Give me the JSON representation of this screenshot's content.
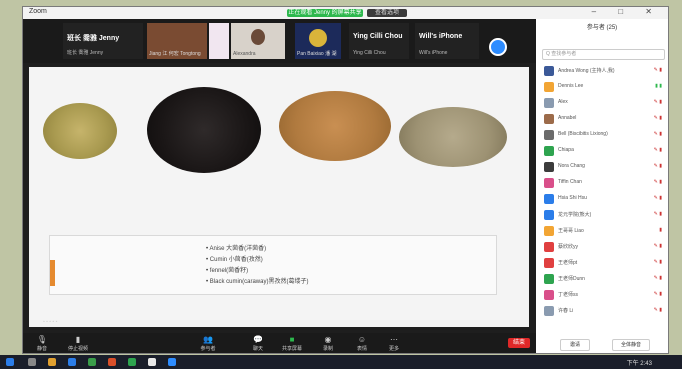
{
  "window": {
    "app_title": "Zoom",
    "recording_pill": "正在观看 Jenny 的屏幕共享",
    "view_pill": "查看选项"
  },
  "participants_strip": [
    {
      "name": "班长 喬雅 Jenny",
      "sub": "班长 喬雅 Jenny"
    },
    {
      "name": "",
      "sub": "Jiang 江 何宏 Tongtong"
    },
    {
      "name": "",
      "sub": "Alexandra"
    },
    {
      "name": "",
      "sub": "Pan Baixiao 潘 湖"
    },
    {
      "name": "Ying Cilli Chou",
      "sub": "Ying Cilli Chou"
    },
    {
      "name": "Will's iPhone",
      "sub": "Will's iPhone"
    }
  ],
  "slide": {
    "bullets": [
      "Anise 大茴香(洋茴香)",
      "Cumin 小茴香(孜然)",
      "fennel(茴香籽)",
      "Black cumin(caraway)黑孜然(葛缕子)"
    ],
    "footer": "◦ ◦ ◦ ◦ ◦"
  },
  "toolbar": {
    "items": [
      {
        "icon": "mic-icon",
        "label": "静音"
      },
      {
        "icon": "camera-icon",
        "label": "停止视频"
      },
      {
        "icon": "participants-icon",
        "label": "参与者"
      },
      {
        "icon": "chat-icon",
        "label": "聊天"
      },
      {
        "icon": "share-icon",
        "label": "共享屏幕"
      },
      {
        "icon": "record-icon",
        "label": "录制"
      },
      {
        "icon": "reactions-icon",
        "label": "表情"
      },
      {
        "icon": "more-icon",
        "label": "更多"
      }
    ],
    "end_label": "结束"
  },
  "panel": {
    "title": "参与者 (25)",
    "search_placeholder": "Q 查找参与者",
    "participants": [
      {
        "name": "Andrea Wong (主持人,我)",
        "color": "#3b5998"
      },
      {
        "name": "Dennis Lee",
        "color": "#f2a534"
      },
      {
        "name": "Alex",
        "color": "#8a9bb0"
      },
      {
        "name": "Annabel",
        "color": "#9c6b4a"
      },
      {
        "name": "Bell (Biscibitis Lixiong)",
        "color": "#6b6b6b"
      },
      {
        "name": "Chiapa",
        "color": "#2ea44f"
      },
      {
        "name": "Nora Chang",
        "color": "#3c3c3c"
      },
      {
        "name": "Tiffin Chan",
        "color": "#d94f8a"
      },
      {
        "name": "Hsia Shi Hsu",
        "color": "#2b7de9"
      },
      {
        "name": "龙元学院(熊大)",
        "color": "#2b7de9"
      },
      {
        "name": "王哥哥 Liao",
        "color": "#f2a534"
      },
      {
        "name": "蔡欣欣yy",
        "color": "#e04040"
      },
      {
        "name": "王老师pt",
        "color": "#e04040"
      },
      {
        "name": "王老师Dunn",
        "color": "#2ea44f"
      },
      {
        "name": "丁老师ss",
        "color": "#d94f8a"
      },
      {
        "name": "许春 Li",
        "color": "#8a9bb0"
      }
    ],
    "invite_label": "邀请",
    "mute_all_label": "全体静音"
  },
  "taskbar": {
    "clock": "下午 2:43"
  }
}
